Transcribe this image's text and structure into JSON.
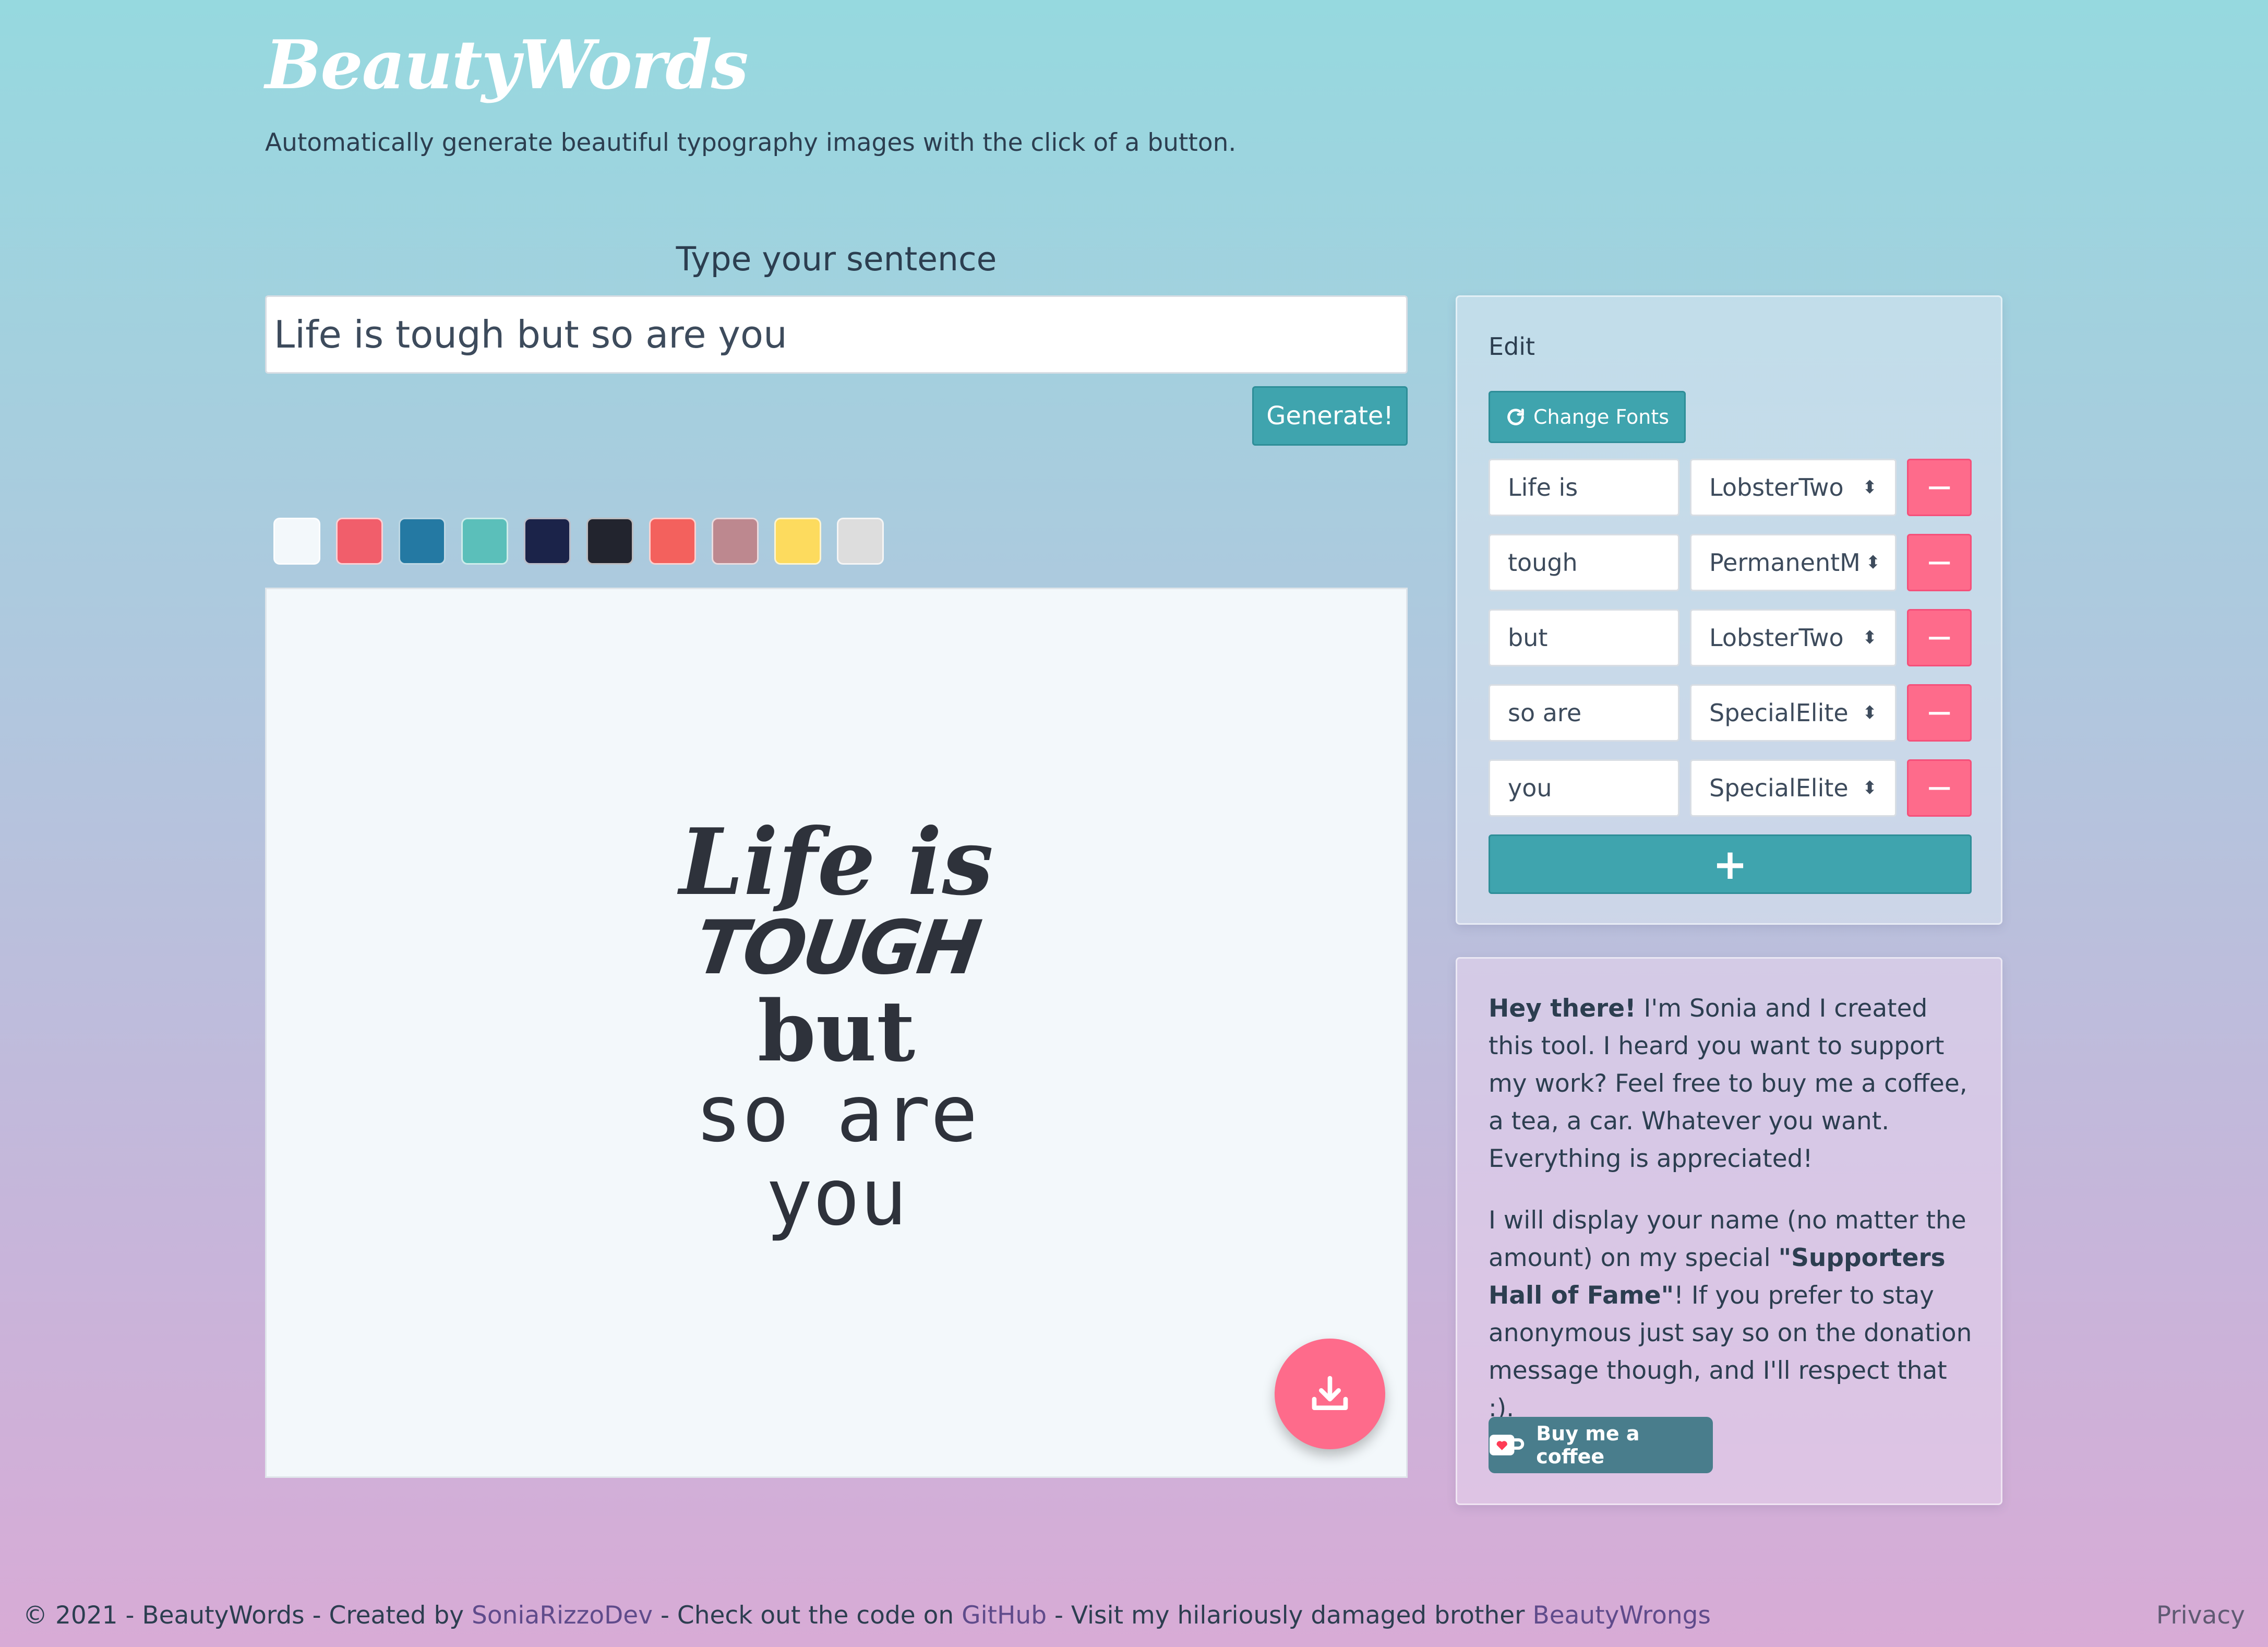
{
  "header": {
    "logo": "BeautyWords",
    "tagline": "Automatically generate beautiful typography images with the click of a button."
  },
  "sentence": {
    "label": "Type your sentence",
    "value": "Life is tough but so are you",
    "generate_label": "Generate!"
  },
  "palette": [
    "#f3f8fb",
    "#f15e6b",
    "#2479a3",
    "#5bbfba",
    "#1b2349",
    "#22242e",
    "#f3615d",
    "#bd888f",
    "#fddb5e",
    "#dddddd"
  ],
  "preview": {
    "lines": [
      "Life is",
      "TOUGH",
      "but",
      "so are",
      "you"
    ],
    "text_color": "#2e323b",
    "background": "#f3f8fb"
  },
  "edit": {
    "title": "Edit",
    "change_fonts_label": "Change Fonts",
    "rows": [
      {
        "word": "Life is",
        "font": "LobsterTwo"
      },
      {
        "word": "tough",
        "font": "PermanentM"
      },
      {
        "word": "but",
        "font": "LobsterTwo"
      },
      {
        "word": "so are",
        "font": "SpecialElite"
      },
      {
        "word": "you",
        "font": "SpecialElite"
      }
    ],
    "remove_label": "−",
    "add_label": "+"
  },
  "support": {
    "p1_bold": "Hey there!",
    "p1_rest": " I'm Sonia and I created this tool. I heard you want to support my work? Feel free to buy me a coffee, a tea, a car. Whatever you want. Everything is appreciated!",
    "p2_pre": "I will display your name (no matter the amount) on my special ",
    "p2_bold": "\"Supporters Hall of Fame\"",
    "p2_post": "! If you prefer to stay anonymous just say so on the donation message though, and I'll respect that :).",
    "coffee_label": "Buy me a coffee"
  },
  "footer": {
    "part1": "© 2021 - BeautyWords - Created by ",
    "link1": "SoniaRizzoDev",
    "part2": " - Check out the code on ",
    "link2": "GitHub",
    "part3": " - Visit my hilariously damaged brother ",
    "link3": "BeautyWrongs",
    "privacy": "Privacy"
  }
}
